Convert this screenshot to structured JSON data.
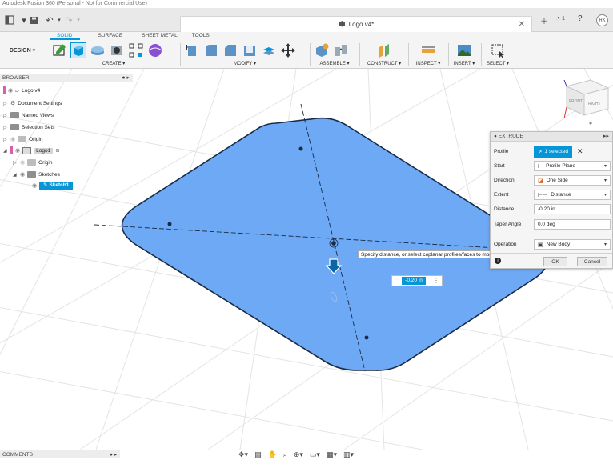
{
  "window": {
    "title_text": "Autodesk Fusion 360 (Personal - Not for Commercial Use)"
  },
  "document": {
    "title": "Logo v4*"
  },
  "user": {
    "initials": "RK",
    "notifications": "1"
  },
  "toolbar": {
    "design_label": "DESIGN ▾",
    "tabs": [
      "SOLID",
      "SURFACE",
      "SHEET METAL",
      "TOOLS"
    ],
    "groups": {
      "create": "CREATE ▾",
      "modify": "MODIFY ▾",
      "assemble": "ASSEMBLE ▾",
      "construct": "CONSTRUCT ▾",
      "inspect": "INSPECT ▾",
      "insert": "INSERT ▾",
      "select": "SELECT ▾"
    }
  },
  "browser": {
    "title": "BROWSER",
    "items": {
      "root": "Logo v4",
      "doc_settings": "Document Settings",
      "named_views": "Named Views",
      "selection_sets": "Selection Sets",
      "origin": "Origin",
      "component": "Logo1",
      "comp_origin": "Origin",
      "sketches": "Sketches",
      "sketch1": "Sketch1"
    }
  },
  "extrude": {
    "title": "EXTRUDE",
    "profile_label": "Profile",
    "profile_value": "1 selected",
    "start_label": "Start",
    "start_value": "Profile Plane",
    "direction_label": "Direction",
    "direction_value": "One Side",
    "extent_label": "Extent",
    "extent_value": "Distance",
    "distance_label": "Distance",
    "distance_value": "-0.20 in",
    "taper_label": "Taper Angle",
    "taper_value": "0.0 deg",
    "operation_label": "Operation",
    "operation_value": "New Body",
    "ok": "OK",
    "cancel": "Cancel"
  },
  "viewport": {
    "tooltip": "Specify distance, or select coplanar profiles/faces to modify the selection",
    "distance_input": "-0.20 in",
    "viewcube": {
      "front": "FRONT",
      "right": "RIGHT"
    }
  },
  "comments": {
    "title": "COMMENTS"
  },
  "colors": {
    "accent": "#0696d7",
    "profile_fill": "#6ea9f5",
    "profile_stroke": "#1a2a44"
  }
}
